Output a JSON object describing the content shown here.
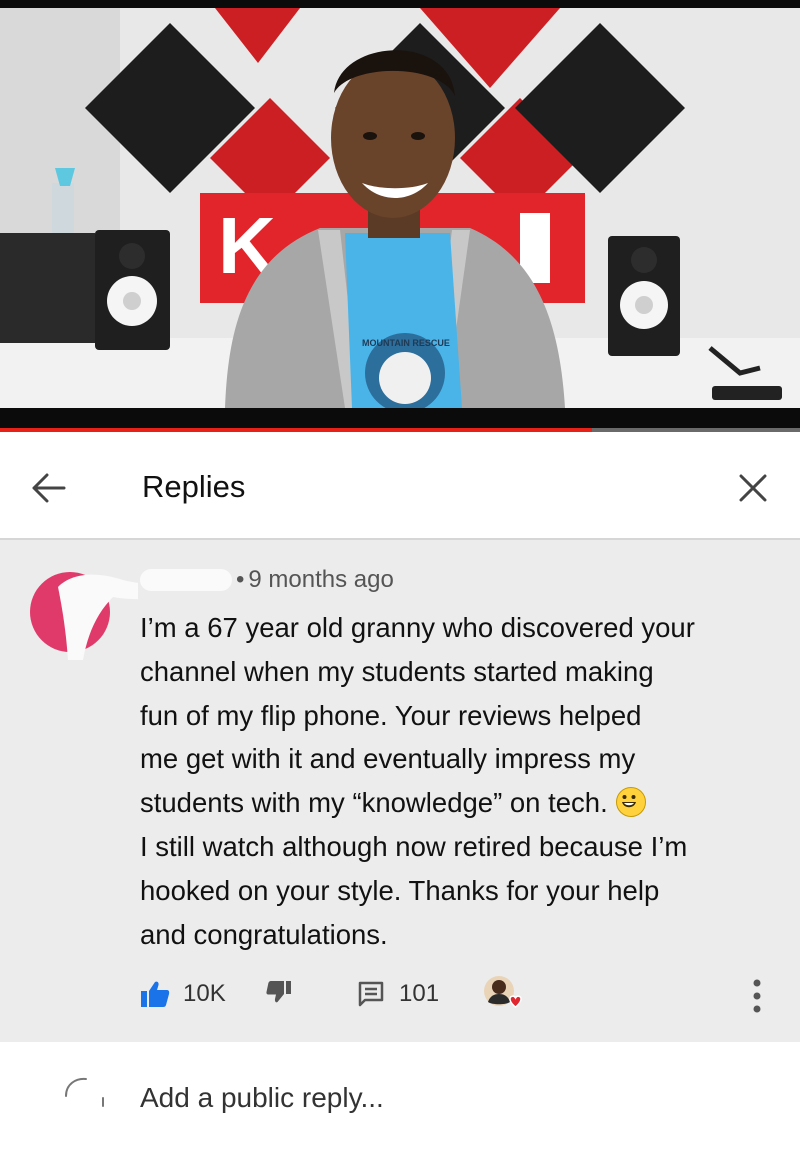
{
  "video": {
    "sign_text": "K",
    "shirt_text": "MOUNTAIN RESCUE",
    "progress": 0.74
  },
  "header": {
    "title": "Replies",
    "back_icon": "arrow-left-icon",
    "close_icon": "close-icon"
  },
  "comment": {
    "timestamp": "9 months ago",
    "separator": "•",
    "lines": [
      "I’m a 67 year old granny who discovered your",
      "channel when my students started making",
      "fun of my flip phone. Your reviews helped",
      "me get with it and eventually impress my",
      "students with my “knowledge” on tech.",
      "I still watch although now retired because I’m",
      "hooked on your style. Thanks for your help",
      "and congratulations."
    ],
    "emoji": "smiley-face-icon",
    "likes": "10K",
    "replies": "101",
    "like_color": "#1a73e8",
    "heart_color": "#e0262f"
  },
  "reply_box": {
    "placeholder": "Add a public reply..."
  }
}
